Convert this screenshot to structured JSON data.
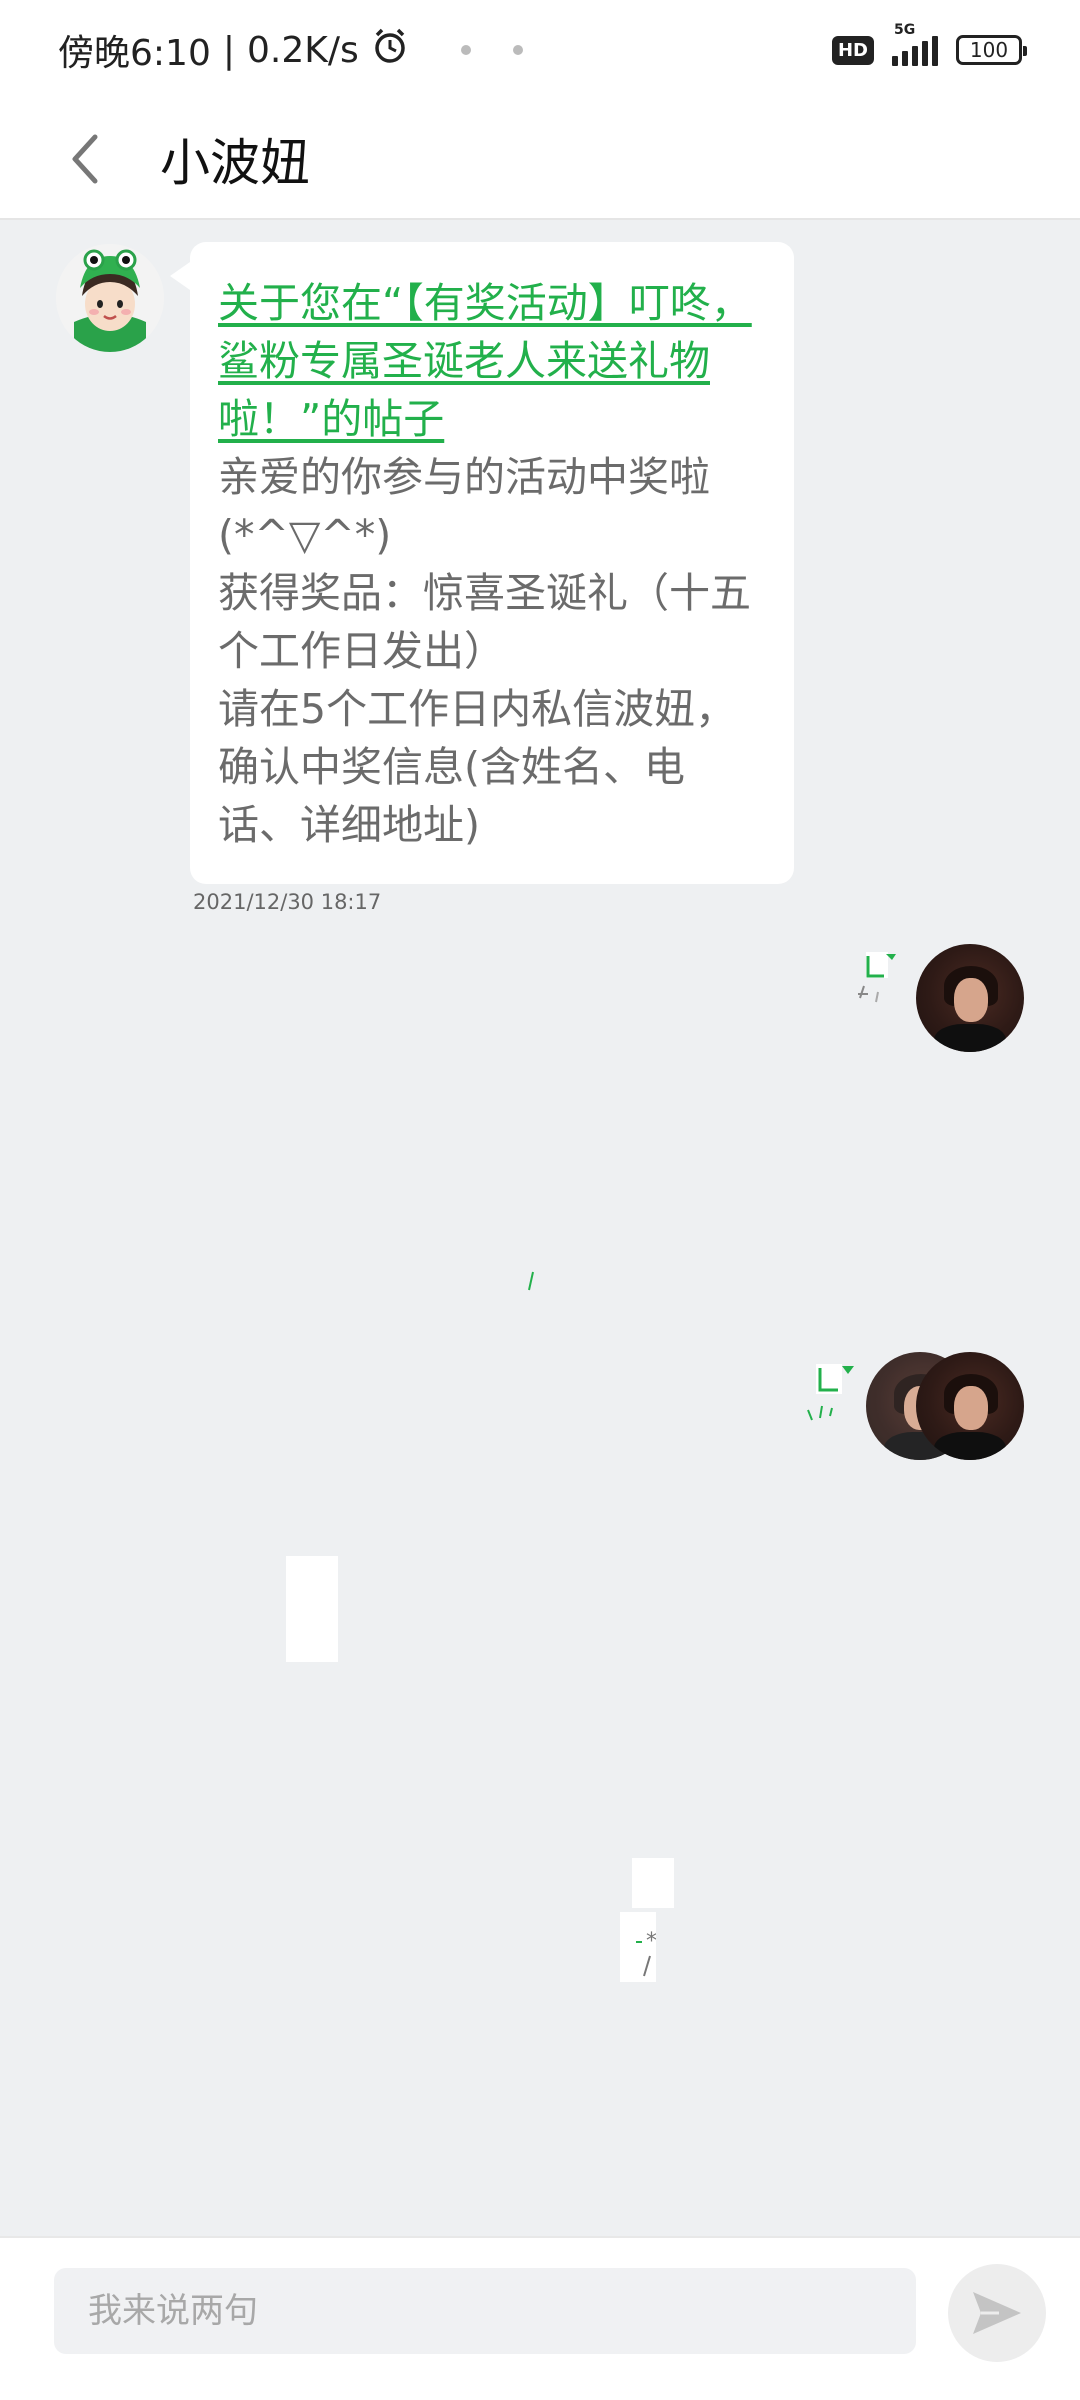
{
  "status_bar": {
    "time": "傍晚6:10",
    "speed": "0.2K/s",
    "hd_badge": "HD",
    "network_type": "5G",
    "battery": "100"
  },
  "header": {
    "title": "小波妞",
    "icons": {
      "back": "chevron-left-icon"
    }
  },
  "messages": [
    {
      "sender": "小波妞",
      "avatar_icon": "girl-avatar",
      "link_text": "关于您在“【有奖活动】叮咚，鲨粉专属圣诞老人来送礼物啦！”的帖子",
      "body_lines": [
        "亲爱的你参与的活动中奖啦(*^▽^*)",
        "获得奖品：惊喜圣诞礼（十五个工作日发出）",
        "请在5个工作日内私信波妞，确认中奖信息(含姓名、电话、详细地址)"
      ],
      "timestamp": "2021/12/30 18:17"
    }
  ],
  "composer": {
    "placeholder": "我来说两句",
    "send_icon": "send-icon"
  },
  "colors": {
    "accent_green": "#22b04b",
    "background": "#eef0f2",
    "text_gray": "#6b6b6b"
  }
}
